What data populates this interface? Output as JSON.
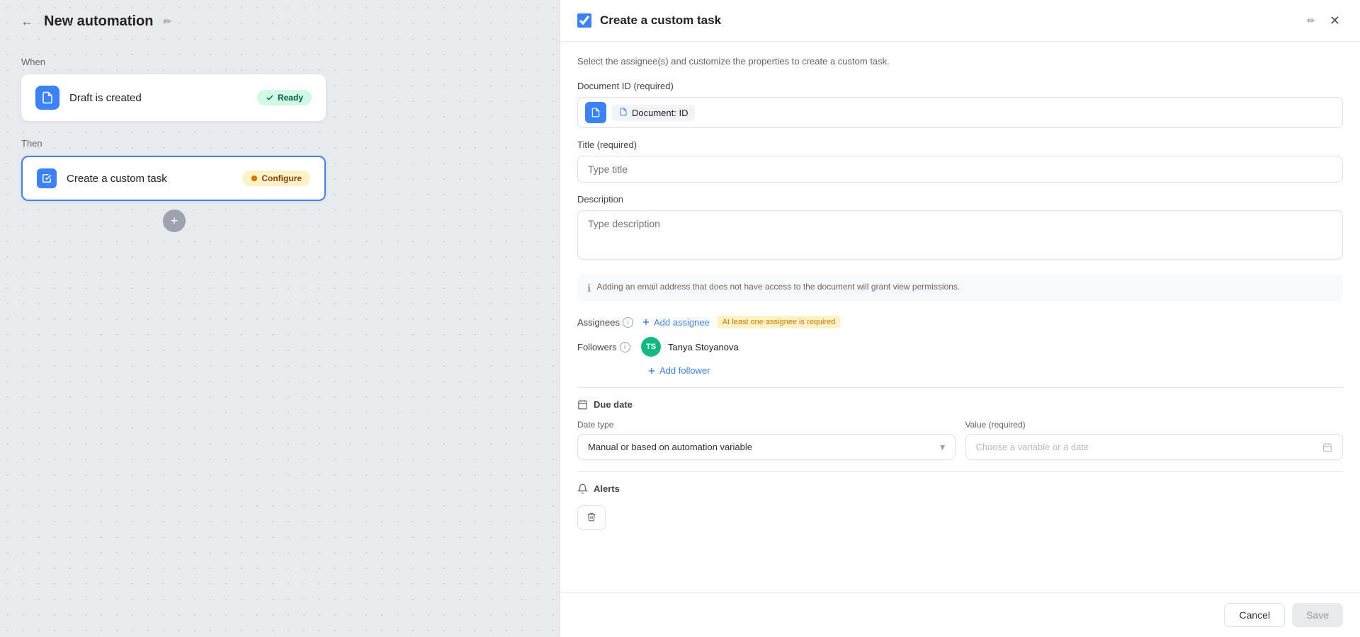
{
  "topbar": {
    "title": "New automation",
    "back_label": "←",
    "edit_icon": "✏"
  },
  "left": {
    "when_label": "When",
    "then_label": "Then",
    "trigger": {
      "name": "Draft is created",
      "status": "Ready",
      "icon": "📄"
    },
    "action": {
      "name": "Create a custom task",
      "status": "Configure",
      "icon": "☑"
    },
    "add_step": "+"
  },
  "panel": {
    "checkbox_checked": true,
    "title": "Create a custom task",
    "edit_icon": "✏",
    "close_icon": "✕",
    "subtitle": "Select the assignee(s) and customize the properties to create a custom task.",
    "doc_id_label": "Document ID (required)",
    "doc_id_value": "Document: ID",
    "title_field_label": "Title (required)",
    "title_placeholder": "Type title",
    "description_label": "Description",
    "description_placeholder": "Type description",
    "info_text": "Adding an email address that does not have access to the document will grant view permissions.",
    "assignees_label": "Assignees",
    "add_assignee_label": "Add assignee",
    "assignees_required": "At least one assignee is required",
    "followers_label": "Followers",
    "follower_name": "Tanya Stoyanova",
    "follower_initials": "TS",
    "add_follower_label": "Add follower",
    "due_date_label": "Due date",
    "date_type_label": "Date type",
    "date_type_value": "Manual or based on automation variable",
    "value_label": "Value (required)",
    "value_placeholder": "Choose a variable or a date",
    "alerts_label": "Alerts",
    "cancel_label": "Cancel",
    "save_label": "Save"
  }
}
